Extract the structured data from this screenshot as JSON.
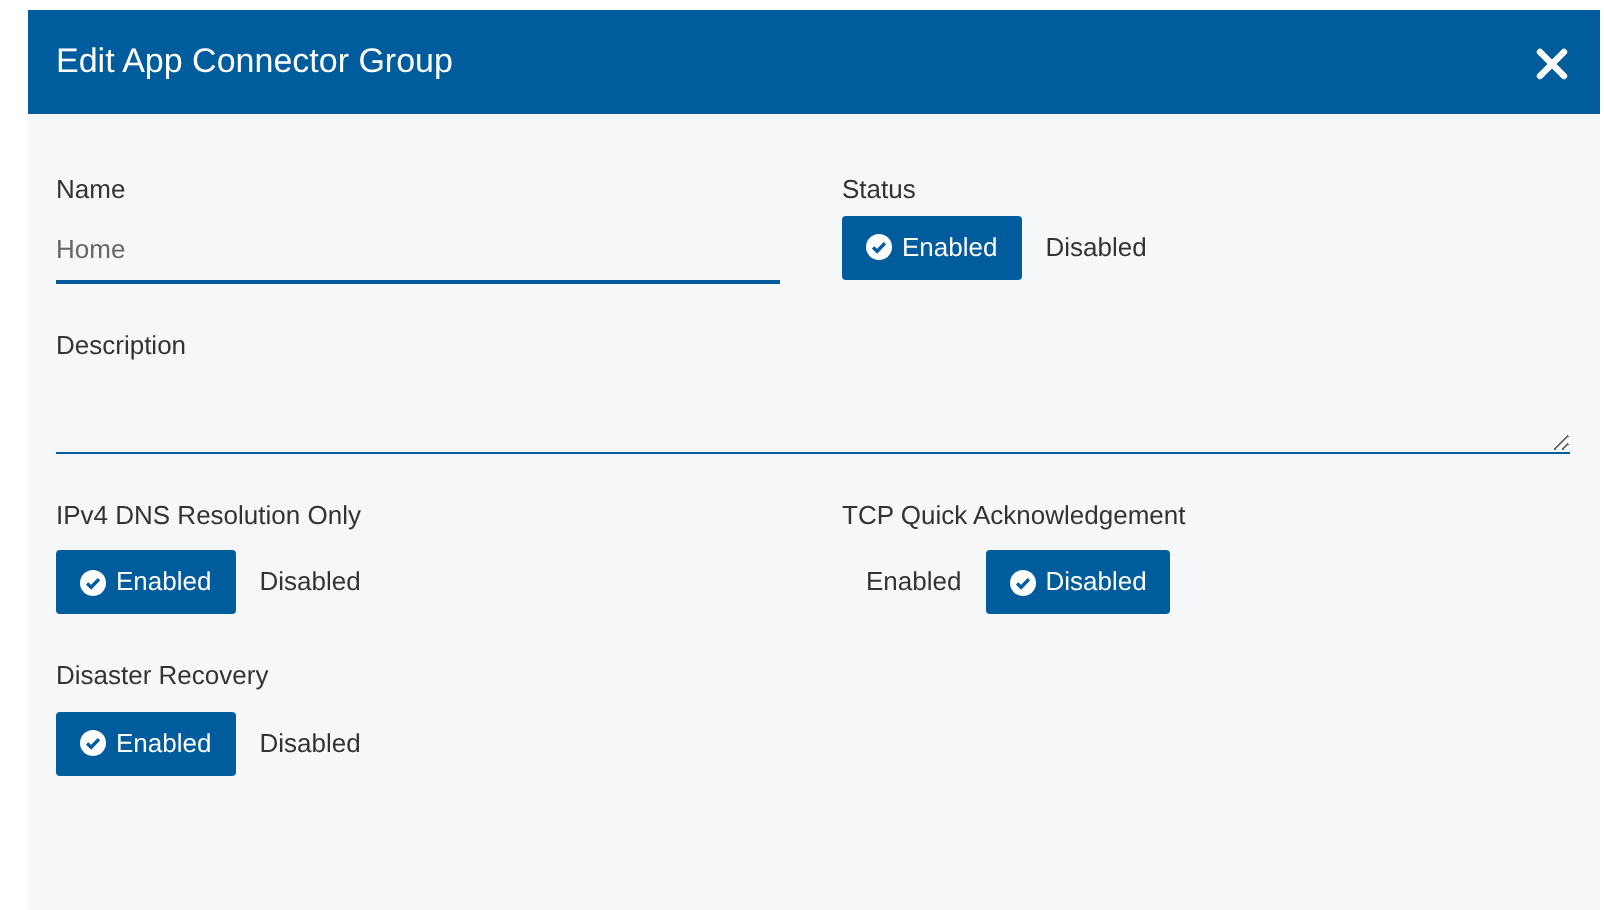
{
  "dialog": {
    "title": "Edit App Connector Group"
  },
  "name_field": {
    "label": "Name",
    "value": "Home"
  },
  "status": {
    "label": "Status",
    "options": [
      {
        "label": "Enabled",
        "selected": true
      },
      {
        "label": "Disabled",
        "selected": false
      }
    ]
  },
  "description_field": {
    "label": "Description"
  },
  "toggles": [
    {
      "label": "IPv4 DNS Resolution Only",
      "options": [
        {
          "label": "Enabled",
          "selected": true
        },
        {
          "label": "Disabled",
          "selected": false
        }
      ]
    },
    {
      "label": "TCP Quick Acknowledgement",
      "options": [
        {
          "label": "Enabled",
          "selected": false
        },
        {
          "label": "Disabled",
          "selected": true
        }
      ]
    },
    {
      "label": "Disaster Recovery",
      "options": [
        {
          "label": "Enabled",
          "selected": true
        },
        {
          "label": "Disabled",
          "selected": false
        }
      ]
    }
  ]
}
